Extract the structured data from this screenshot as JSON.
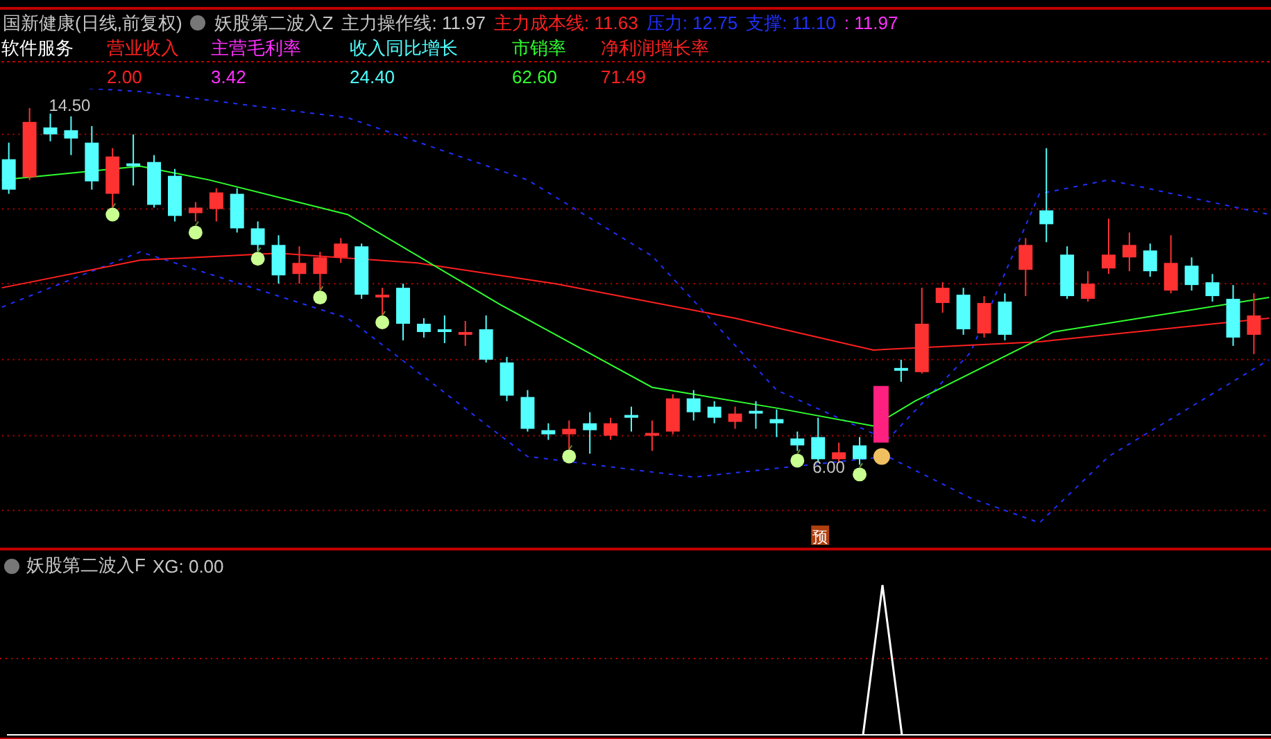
{
  "header": {
    "title": "国新健康(日线,前复权)",
    "indicator": "妖股第二波入Z",
    "legend": [
      {
        "text": "主力操作线: 11.97",
        "color": "#c8c8c8"
      },
      {
        "text": "主力成本线: 11.63",
        "color": "#ff2020"
      },
      {
        "text": "压力: 12.75",
        "color": "#2030ff"
      },
      {
        "text": "支撑: 11.10",
        "color": "#2030ff"
      },
      {
        "text": ": 11.97",
        "color": "#ff30ff"
      }
    ]
  },
  "sector": "软件服务",
  "metrics": [
    {
      "label": "营业收入",
      "value": "2.00",
      "color": "#ff2020"
    },
    {
      "label": "主营毛利率",
      "value": "3.42",
      "color": "#ff30ff"
    },
    {
      "label": "收入同比增长",
      "value": "24.40",
      "color": "#50ffff"
    },
    {
      "label": "市销率",
      "value": "62.60",
      "color": "#30ff30"
    },
    {
      "label": "净利润增长率",
      "value": "71.49",
      "color": "#ff2020"
    }
  ],
  "chart": {
    "high_label": "14.50",
    "low_label": "6.00",
    "forecast_badge": "预"
  },
  "lower_panel": {
    "indicator": "妖股第二波入F",
    "reading": "XG: 0.00"
  }
}
